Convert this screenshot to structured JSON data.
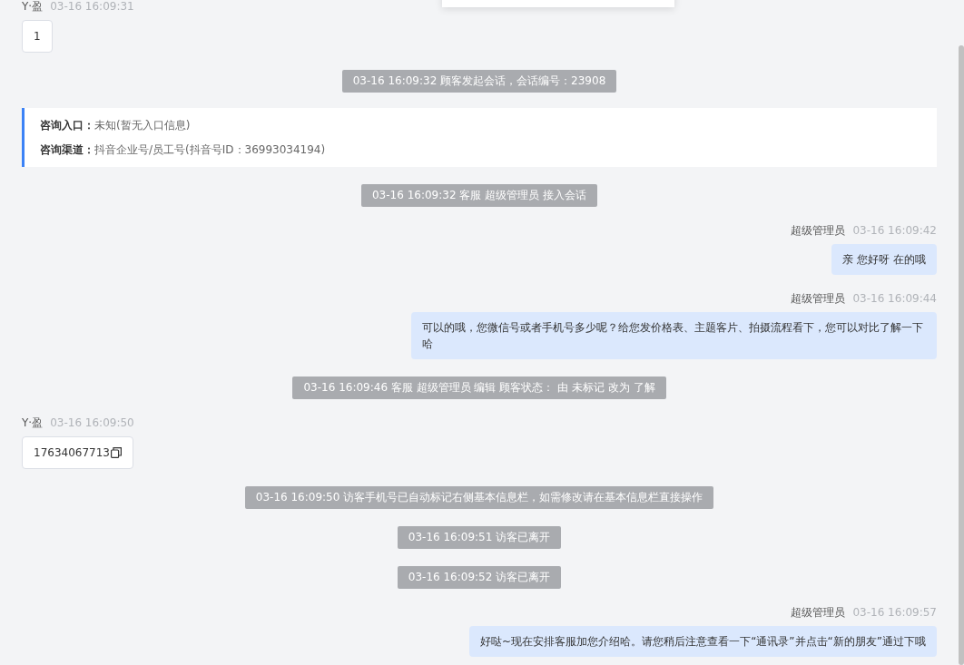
{
  "messages": [
    {
      "kind": "visitor",
      "sender": "Y·盈",
      "time": "03-16 16:09:31",
      "text": "1",
      "copyable": false
    },
    {
      "kind": "system",
      "text": "03-16 16:09:32 顾客发起会话，会话编号：23908"
    },
    {
      "kind": "info",
      "rows": [
        {
          "label": "咨询入口：",
          "value": "未知(暂无入口信息)"
        },
        {
          "label": "咨询渠道：",
          "value": "抖音企业号/员工号(抖音号ID：36993034194)"
        }
      ]
    },
    {
      "kind": "system",
      "text": "03-16 16:09:32 客服 超级管理员 接入会话"
    },
    {
      "kind": "agent",
      "sender": "超级管理员",
      "time": "03-16 16:09:42",
      "text": "亲 您好呀 在的哦"
    },
    {
      "kind": "agent",
      "sender": "超级管理员",
      "time": "03-16 16:09:44",
      "text": "可以的哦，您微信号或者手机号多少呢？给您发价格表、主题客片、拍摄流程看下，您可以对比了解一下哈"
    },
    {
      "kind": "system",
      "text": "03-16 16:09:46 客服 超级管理员 编辑 顾客状态： 由 未标记 改为 了解"
    },
    {
      "kind": "visitor",
      "sender": "Y·盈",
      "time": "03-16 16:09:50",
      "text": "17634067713",
      "copyable": true
    },
    {
      "kind": "system",
      "text": "03-16 16:09:50 访客手机号已自动标记右侧基本信息栏，如需修改请在基本信息栏直接操作"
    },
    {
      "kind": "system",
      "text": "03-16 16:09:51 访客已离开"
    },
    {
      "kind": "system",
      "text": "03-16 16:09:52 访客已离开"
    },
    {
      "kind": "agent",
      "sender": "超级管理员",
      "time": "03-16 16:09:57",
      "text": "好哒~现在安排客服加您介绍哈。请您稍后注意查看一下“通讯录”并点击“新的朋友”通过下哦"
    }
  ]
}
